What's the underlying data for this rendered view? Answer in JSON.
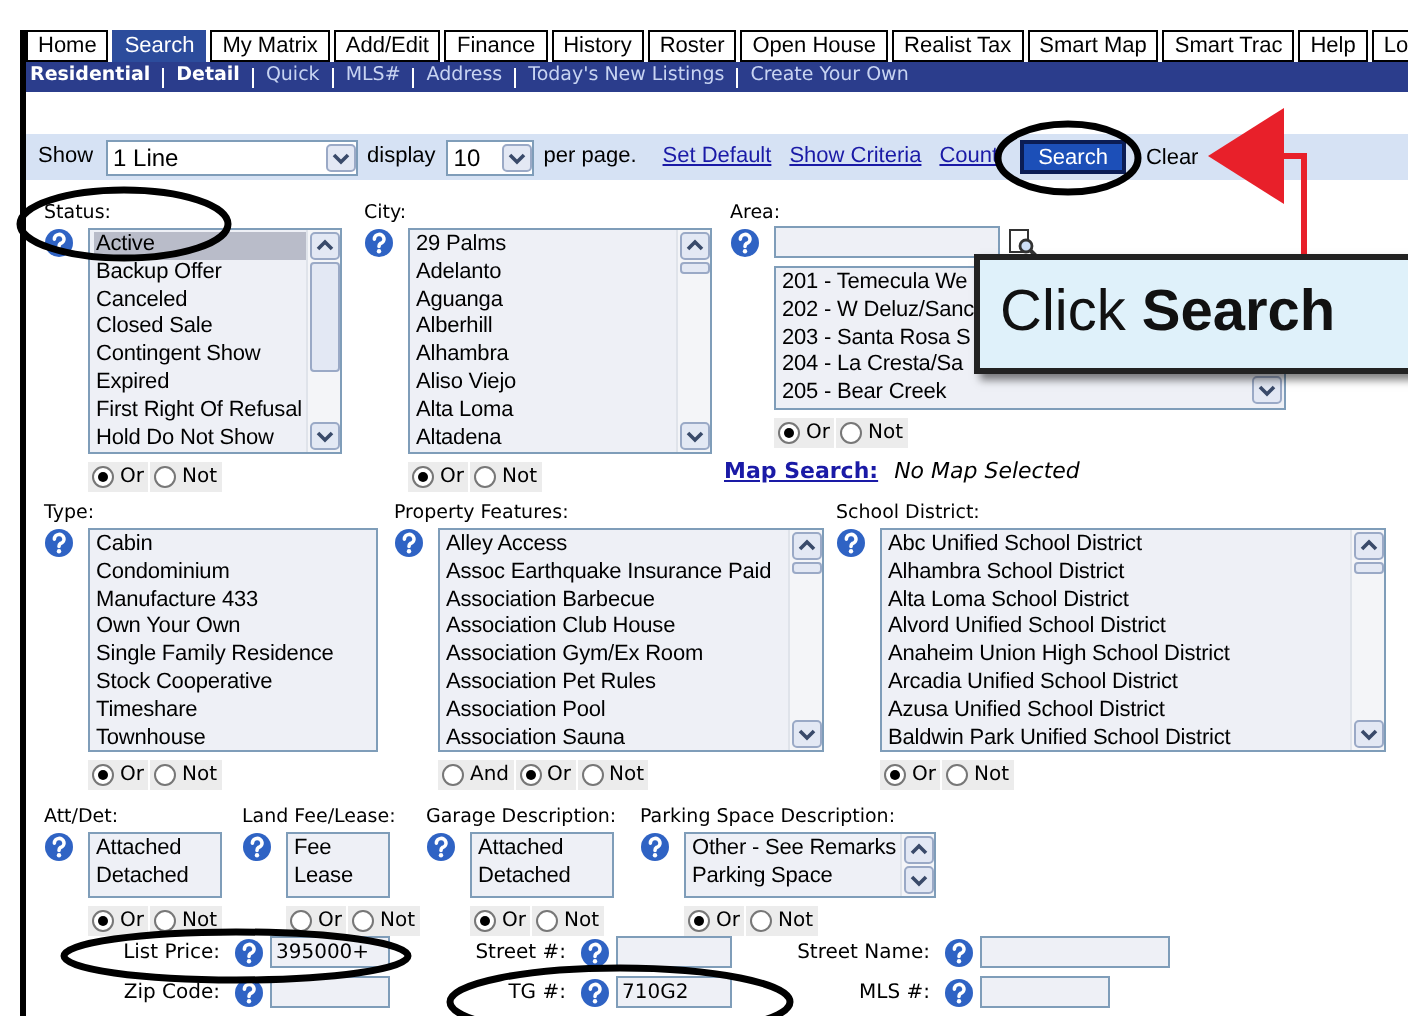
{
  "tabs": [
    {
      "label": "Home",
      "selected": false
    },
    {
      "label": "Search",
      "selected": true
    },
    {
      "label": "My Matrix",
      "selected": false
    },
    {
      "label": "Add/Edit",
      "selected": false
    },
    {
      "label": "Finance",
      "selected": false
    },
    {
      "label": "History",
      "selected": false
    },
    {
      "label": "Roster",
      "selected": false
    },
    {
      "label": "Open House",
      "selected": false
    },
    {
      "label": "Realist Tax",
      "selected": false
    },
    {
      "label": "Smart Map",
      "selected": false
    },
    {
      "label": "Smart Trac",
      "selected": false
    },
    {
      "label": "Help",
      "selected": false
    },
    {
      "label": "Lo",
      "selected": false
    }
  ],
  "subnav": [
    {
      "label": "Residential",
      "selected": true
    },
    {
      "label": "Detail",
      "selected": true
    },
    {
      "label": "Quick",
      "selected": false
    },
    {
      "label": "MLS#",
      "selected": false
    },
    {
      "label": "Address",
      "selected": false
    },
    {
      "label": "Today's New Listings",
      "selected": false
    },
    {
      "label": "Create Your Own",
      "selected": false
    }
  ],
  "toolbar": {
    "show_label": "Show",
    "show_value": "1 Line",
    "display_label": "display",
    "display_value": "10",
    "per_page_label": "per page.",
    "links": [
      "Set Default",
      "Show Criteria",
      "Count"
    ],
    "search_button": "Search",
    "clear_button": "Clear"
  },
  "criteria_rows": [
    {
      "fields": [
        {
          "kind": "listbox",
          "label": "Status:",
          "scrollbar": true,
          "items": [
            {
              "label": "Active",
              "selected": true
            },
            {
              "label": "Backup Offer",
              "selected": false
            },
            {
              "label": "Canceled",
              "selected": false
            },
            {
              "label": "Closed Sale",
              "selected": false
            },
            {
              "label": "Contingent Show",
              "selected": false
            },
            {
              "label": "Expired",
              "selected": false
            },
            {
              "label": "First Right Of Refusal",
              "selected": false
            },
            {
              "label": "Hold Do Not Show",
              "selected": false
            }
          ],
          "options": [
            {
              "label": "Or",
              "checked": true
            },
            {
              "label": "Not",
              "checked": false
            }
          ]
        },
        {
          "kind": "listbox",
          "label": "City:",
          "scrollbar": true,
          "items": [
            {
              "label": "29 Palms",
              "selected": false
            },
            {
              "label": "Adelanto",
              "selected": false
            },
            {
              "label": "Aguanga",
              "selected": false
            },
            {
              "label": "Alberhill",
              "selected": false
            },
            {
              "label": "Alhambra",
              "selected": false
            },
            {
              "label": "Aliso Viejo",
              "selected": false
            },
            {
              "label": "Alta Loma",
              "selected": false
            },
            {
              "label": "Altadena",
              "selected": false
            }
          ],
          "options": [
            {
              "label": "Or",
              "checked": true
            },
            {
              "label": "Not",
              "checked": false
            }
          ]
        },
        {
          "kind": "area",
          "label": "Area:",
          "scrollbar": true,
          "items": [
            {
              "label": "201 - Temecula We",
              "selected": false
            },
            {
              "label": "202 - W Deluz/Sanc",
              "selected": false
            },
            {
              "label": "203 - Santa Rosa S",
              "selected": false
            },
            {
              "label": "204 - La Cresta/Sa",
              "selected": false
            },
            {
              "label": "205 - Bear Creek",
              "selected": false
            }
          ],
          "options": [
            {
              "label": "Or",
              "checked": true
            },
            {
              "label": "Not",
              "checked": false
            }
          ],
          "map_link": "Map Search:",
          "map_status": "No Map Selected"
        }
      ]
    },
    {
      "fields": [
        {
          "kind": "listbox",
          "label": "Type:",
          "items": [
            {
              "label": "Cabin",
              "selected": false
            },
            {
              "label": "Condominium",
              "selected": false
            },
            {
              "label": "Manufacture 433",
              "selected": false
            },
            {
              "label": "Own Your Own",
              "selected": false
            },
            {
              "label": "Single Family Residence",
              "selected": false
            },
            {
              "label": "Stock Cooperative",
              "selected": false
            },
            {
              "label": "Timeshare",
              "selected": false
            },
            {
              "label": "Townhouse",
              "selected": false
            }
          ],
          "options": [
            {
              "label": "Or",
              "checked": true
            },
            {
              "label": "Not",
              "checked": false
            }
          ]
        },
        {
          "kind": "listbox",
          "label": "Property Features:",
          "scrollbar": true,
          "items": [
            {
              "label": "Alley Access",
              "selected": false
            },
            {
              "label": "Assoc Earthquake Insurance Paid",
              "selected": false
            },
            {
              "label": "Association Barbecue",
              "selected": false
            },
            {
              "label": "Association Club House",
              "selected": false
            },
            {
              "label": "Association Gym/Ex Room",
              "selected": false
            },
            {
              "label": "Association Pet Rules",
              "selected": false
            },
            {
              "label": "Association Pool",
              "selected": false
            },
            {
              "label": "Association Sauna",
              "selected": false
            }
          ],
          "options": [
            {
              "label": "And",
              "checked": false
            },
            {
              "label": "Or",
              "checked": true
            },
            {
              "label": "Not",
              "checked": false
            }
          ]
        },
        {
          "kind": "listbox",
          "label": "School District:",
          "scrollbar": true,
          "items": [
            {
              "label": "Abc Unified School District",
              "selected": false
            },
            {
              "label": "Alhambra School District",
              "selected": false
            },
            {
              "label": "Alta Loma School District",
              "selected": false
            },
            {
              "label": "Alvord Unified School District",
              "selected": false
            },
            {
              "label": "Anaheim Union High School District",
              "selected": false
            },
            {
              "label": "Arcadia Unified School District",
              "selected": false
            },
            {
              "label": "Azusa Unified School District",
              "selected": false
            },
            {
              "label": "Baldwin Park Unified School District",
              "selected": false
            }
          ],
          "options": [
            {
              "label": "Or",
              "checked": true
            },
            {
              "label": "Not",
              "checked": false
            }
          ]
        }
      ]
    },
    {
      "fields": [
        {
          "kind": "listbox",
          "label": "Att/Det:",
          "items": [
            {
              "label": "Attached",
              "selected": false
            },
            {
              "label": "Detached",
              "selected": false
            }
          ],
          "options": [
            {
              "label": "Or",
              "checked": true
            },
            {
              "label": "Not",
              "checked": false
            }
          ]
        },
        {
          "kind": "listbox",
          "label": "Land Fee/Lease:",
          "items": [
            {
              "label": "Fee",
              "selected": false
            },
            {
              "label": "Lease",
              "selected": false
            }
          ],
          "options": [
            {
              "label": "Or",
              "checked": false
            },
            {
              "label": "Not",
              "checked": false
            }
          ]
        },
        {
          "kind": "listbox",
          "label": "Garage Description:",
          "items": [
            {
              "label": "Attached",
              "selected": false
            },
            {
              "label": "Detached",
              "selected": false
            }
          ],
          "options": [
            {
              "label": "Or",
              "checked": true
            },
            {
              "label": "Not",
              "checked": false
            }
          ]
        },
        {
          "kind": "listbox",
          "label": "Parking Space Description:",
          "scrollbar": true,
          "items": [
            {
              "label": "Other - See Remarks",
              "selected": false
            },
            {
              "label": "Parking Space",
              "selected": false
            }
          ],
          "options": [
            {
              "label": "Or",
              "checked": true
            },
            {
              "label": "Not",
              "checked": false
            }
          ]
        }
      ]
    }
  ],
  "text_fields": [
    {
      "label": "List Price:",
      "value": "395000+"
    },
    {
      "label": "Street #:"
    },
    {
      "label": "Street Name:"
    },
    {
      "label": "Zip Code:"
    },
    {
      "label": "TG #:",
      "value": "710G2"
    },
    {
      "label": "MLS #:"
    }
  ],
  "callout": "Click **Search**"
}
